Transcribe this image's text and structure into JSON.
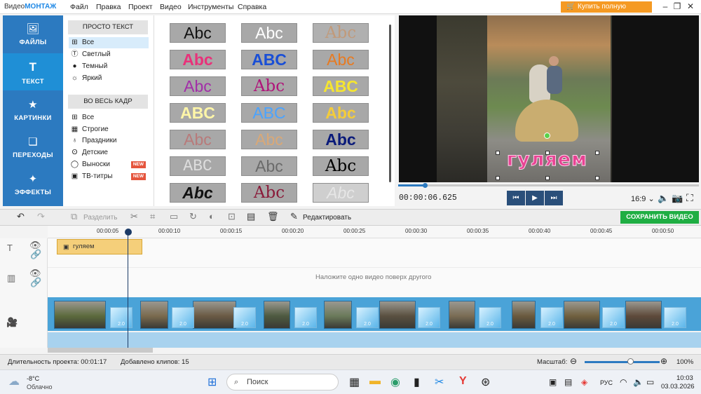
{
  "app": {
    "logo_a": "Видео",
    "logo_b": "МОНТАЖ",
    "buy_label": "Купить полную версию"
  },
  "menu": [
    "Файл",
    "Правка",
    "Проект",
    "Видео",
    "Инструменты",
    "Справка"
  ],
  "leftnav": [
    {
      "label": "ФАЙЛЫ",
      "icon": "image-icon"
    },
    {
      "label": "ТЕКСТ",
      "icon": "text-icon"
    },
    {
      "label": "КАРТИНКИ",
      "icon": "star-icon"
    },
    {
      "label": "ПЕРЕХОДЫ",
      "icon": "transitions-icon"
    },
    {
      "label": "ЭФФЕКТЫ",
      "icon": "wand-icon"
    }
  ],
  "categories": {
    "simple_head": "ПРОСТО ТЕКСТ",
    "simple": [
      "Все",
      "Светлый",
      "Темный",
      "Яркий"
    ],
    "full_head": "ВО ВЕСЬ КАДР",
    "full": [
      "Все",
      "Строгие",
      "Праздники",
      "Детские",
      "Выноски",
      "ТВ-титры"
    ],
    "new_badge": "NEW"
  },
  "styles": {
    "row1": [
      "Abc",
      "Abc",
      "Abc"
    ],
    "row2": [
      "Abc",
      "ABC",
      "Abc"
    ],
    "row3": [
      "Abc",
      "Abc",
      "ABC"
    ],
    "row4": [
      "ABC",
      "ABC",
      "Abc"
    ],
    "row5": [
      "Abc",
      "Abc",
      "Abc"
    ],
    "row6": [
      "ABC",
      "Abc",
      "Abc"
    ],
    "row7": [
      "Abc",
      "Abc",
      "Abc"
    ]
  },
  "preview": {
    "overlay_text": "гуляем",
    "timecode": "00:00:06.625",
    "aspect": "16:9",
    "playback_progress": 0.09
  },
  "toolbar": {
    "split_label": "Разделить",
    "edit_label": "Редактировать",
    "save_label": "СОХРАНИТЬ ВИДЕО"
  },
  "ruler": [
    "00:00:05",
    "00:00:10",
    "00:00:15",
    "00:00:20",
    "00:00:25",
    "00:00:30",
    "00:00:35",
    "00:00:40",
    "00:00:45",
    "00:00:50"
  ],
  "timeline": {
    "text_clip": "гуляем",
    "overlay_hint": "Наложите одно видео поверх другого",
    "transition_duration": "2.0"
  },
  "status": {
    "duration_label": "Длительность проекта:",
    "duration": "00:01:17",
    "clips_label": "Добавлено клипов:",
    "clips": "15",
    "zoom_label": "Масштаб:",
    "zoom": "100%",
    "zoom_level": 0.6
  },
  "taskbar": {
    "temp": "-8°C",
    "weather": "Облачно",
    "search": "Поиск",
    "lang": "РУС",
    "time": "10:03",
    "date": "03.03.2026"
  }
}
